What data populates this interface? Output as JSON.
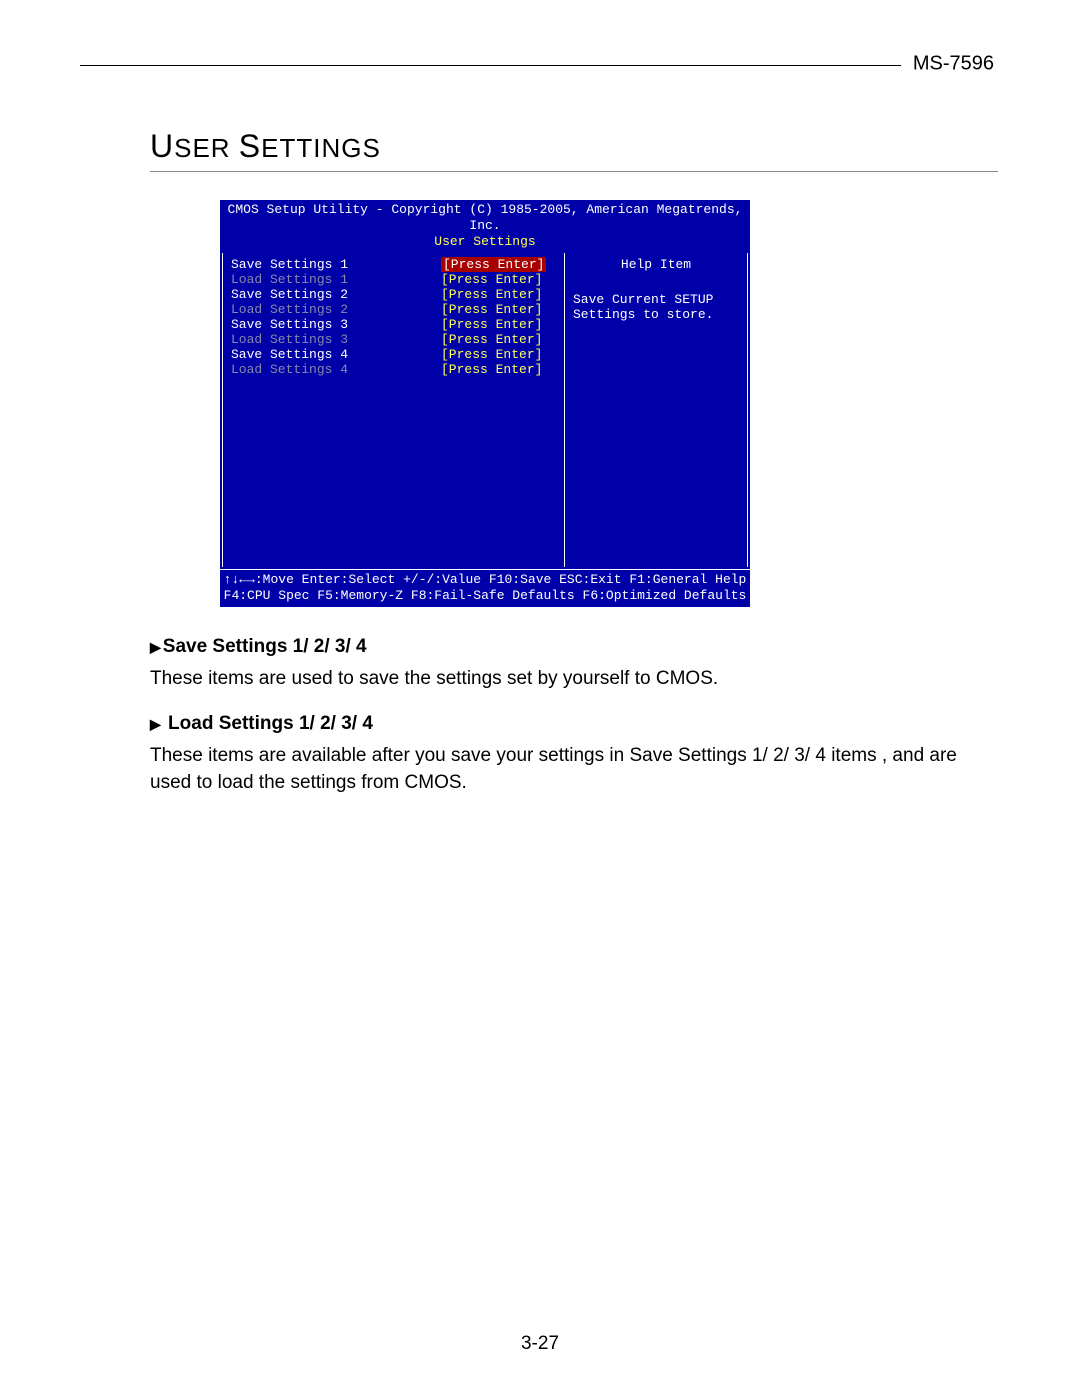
{
  "header": {
    "model": "MS-7596"
  },
  "section": {
    "title_caps_1": "U",
    "title_rest_1": "SER ",
    "title_caps_2": "S",
    "title_rest_2": "ETTINGS"
  },
  "bios": {
    "copyright": "CMOS Setup Utility - Copyright (C) 1985-2005, American Megatrends, Inc.",
    "subtitle": "User Settings",
    "items": [
      {
        "label": "Save Settings 1",
        "value": "[Press Enter]",
        "enabled": true,
        "selected": true
      },
      {
        "label": "Load Settings 1",
        "value": "[Press Enter]",
        "enabled": false,
        "selected": false
      },
      {
        "label": "Save Settings 2",
        "value": "[Press Enter]",
        "enabled": true,
        "selected": false
      },
      {
        "label": "Load Settings 2",
        "value": "[Press Enter]",
        "enabled": false,
        "selected": false
      },
      {
        "label": "Save Settings 3",
        "value": "[Press Enter]",
        "enabled": true,
        "selected": false
      },
      {
        "label": "Load Settings 3",
        "value": "[Press Enter]",
        "enabled": false,
        "selected": false
      },
      {
        "label": "Save Settings 4",
        "value": "[Press Enter]",
        "enabled": true,
        "selected": false
      },
      {
        "label": "Load Settings 4",
        "value": "[Press Enter]",
        "enabled": false,
        "selected": false
      }
    ],
    "help": {
      "title": "Help Item",
      "body1": "Save Current SETUP",
      "body2": "Settings to store."
    },
    "footer1": "↑↓←→:Move  Enter:Select  +/-/:Value  F10:Save  ESC:Exit  F1:General Help",
    "footer2": "F4:CPU Spec  F5:Memory-Z  F8:Fail-Safe Defaults  F6:Optimized Defaults"
  },
  "descriptions": [
    {
      "heading": "Save Settings 1/ 2/ 3/ 4",
      "body": "These items are used to save the settings set by yourself to CMOS."
    },
    {
      "heading": " Load Settings 1/ 2/ 3/ 4",
      "body": "These items are available after you save your settings in Save Settings 1/ 2/ 3/ 4 items , and are used to load the settings from CMOS."
    }
  ],
  "page_number": "3-27"
}
